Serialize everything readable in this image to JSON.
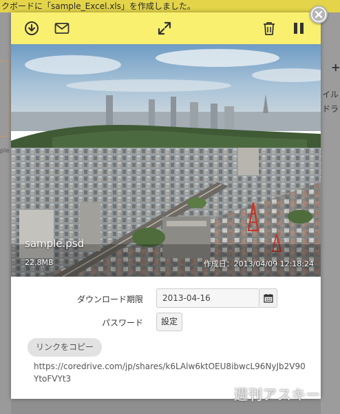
{
  "background": {
    "banner_text": "クボードに「sample_Excel.xls」を作成しました。",
    "left_fragment": "ple",
    "right_plus": "+",
    "right_text_1": "イル",
    "right_text_2": "ドラ"
  },
  "toolbar": {
    "icons": [
      "download-icon",
      "mail-icon",
      "expand-icon",
      "trash-icon",
      "pause-icon"
    ]
  },
  "file": {
    "name": "sample.psd",
    "size": "22.8MB",
    "created": "作成日：2013/04/09 12:18:24"
  },
  "form": {
    "expiry_label": "ダウンロード期限",
    "expiry_value": "2013-04-16",
    "password_label": "パスワード",
    "password_button": "設定",
    "copy_link_button": "リンクをコピー",
    "share_url": "https://coredrive.com/jp/shares/k6LAlw6ktOEU8ibwcL96NyJb2V90YtoFVYt3"
  },
  "watermark": "週刊アスキー",
  "colors": {
    "toolbar": "#faf070",
    "banner": "#e3d44a",
    "overlay": "#8f8f8f"
  }
}
